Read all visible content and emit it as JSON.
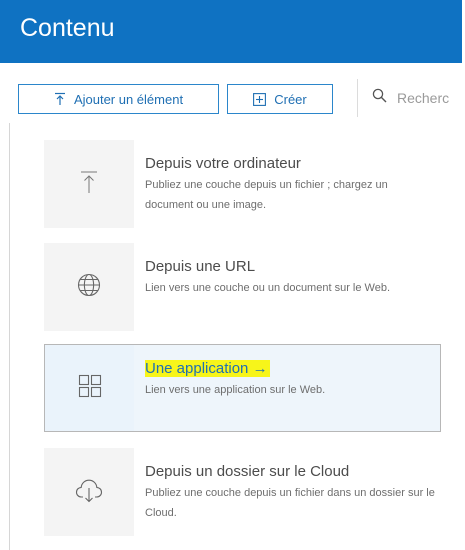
{
  "header": {
    "title": "Contenu"
  },
  "toolbar": {
    "add_label": "Ajouter un élément",
    "create_label": "Créer",
    "search_placeholder": "Recherc"
  },
  "menu": {
    "items": [
      {
        "title": "Depuis votre ordinateur",
        "description": "Publiez une couche depuis un fichier ; chargez un document ou une image.",
        "icon": "upload-icon"
      },
      {
        "title": "Depuis une URL",
        "description": "Lien vers une couche ou un document sur le Web.",
        "icon": "globe-icon"
      },
      {
        "title": "Une application",
        "arrow": "→",
        "description": "Lien vers une application sur le Web.",
        "icon": "apps-grid-icon",
        "highlighted": true
      },
      {
        "title": "Depuis un dossier sur le Cloud",
        "description": "Publiez une couche depuis un fichier dans un dossier sur le Cloud.",
        "icon": "cloud-download-icon"
      }
    ]
  },
  "colors": {
    "header_bg": "#0f72c2",
    "accent": "#1f6fb3",
    "highlight": "#f7f51a",
    "icon_box_bg": "#f4f4f4",
    "selected_bg": "#eef5fb"
  }
}
